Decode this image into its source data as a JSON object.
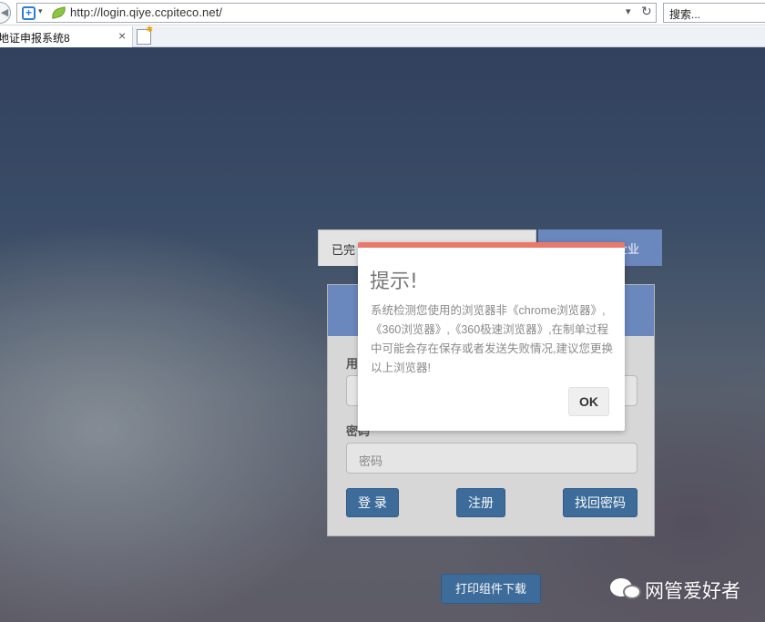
{
  "browser": {
    "url": "http://login.qiye.ccpiteco.net/",
    "search_placeholder": "搜索...",
    "tab_title": "地证申报系统8",
    "tab_close": "×",
    "refresh_glyph": "↻",
    "caret_glyph": "▾"
  },
  "login": {
    "tab_left_label": "已完",
    "tab_right_label": "企业",
    "username_label": "用",
    "password_label": "密码",
    "password_placeholder": "密码",
    "login_button": "登 录",
    "register_button": "注册",
    "forgot_button": "找回密码",
    "print_button": "打印组件下载"
  },
  "dialog": {
    "title": "提示!",
    "message": "系统检测您使用的浏览器非《chrome浏览器》,《360浏览器》,《360极速浏览器》,在制单过程中可能会存在保存或者发送失败情况,建议您更换以上浏览器!",
    "ok_label": "OK",
    "accent_color": "#e9796a"
  },
  "watermark": {
    "text": "网管爱好者"
  }
}
